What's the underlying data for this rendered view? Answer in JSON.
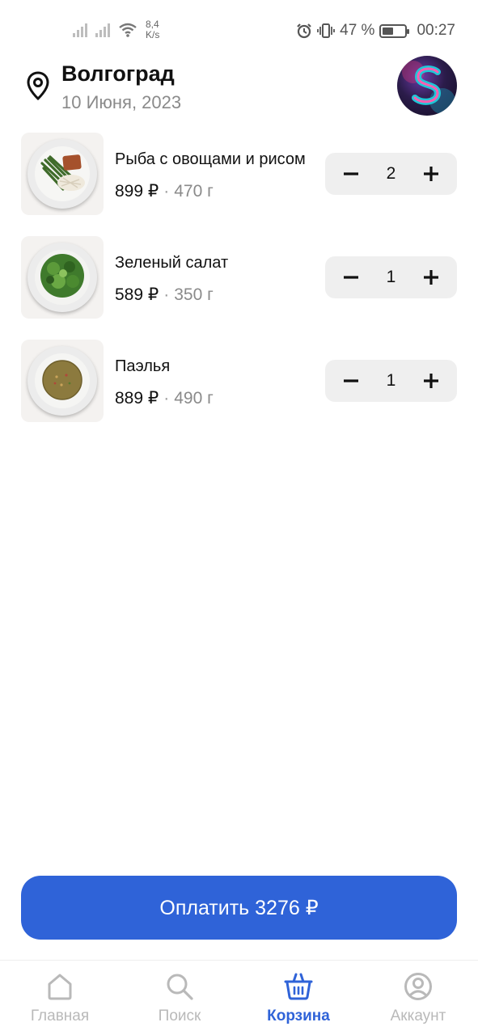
{
  "status_bar": {
    "net_speed_value": "8,4",
    "net_speed_unit": "K/s",
    "battery_percent": "47 %",
    "battery_level": 0.47,
    "time": "00:27"
  },
  "header": {
    "city": "Волгоград",
    "date": "10 Июня, 2023"
  },
  "cart": {
    "items": [
      {
        "name": "Рыба с овощами и рисом",
        "price": "899 ₽",
        "separator": "·",
        "weight": "470 г",
        "quantity": "2"
      },
      {
        "name": "Зеленый салат",
        "price": "589 ₽",
        "separator": "·",
        "weight": "350 г",
        "quantity": "1"
      },
      {
        "name": "Паэлья",
        "price": "889 ₽",
        "separator": "·",
        "weight": "490 г",
        "quantity": "1"
      }
    ]
  },
  "pay_button": {
    "label": "Оплатить 3276 ₽"
  },
  "bottom_nav": {
    "items": [
      {
        "label": "Главная",
        "icon": "home-icon"
      },
      {
        "label": "Поиск",
        "icon": "search-icon"
      },
      {
        "label": "Корзина",
        "icon": "basket-icon",
        "active": true
      },
      {
        "label": "Аккаунт",
        "icon": "account-icon"
      }
    ]
  },
  "colors": {
    "accent": "#2f63d8",
    "inactive_nav": "#b9b9b9",
    "secondary_text": "#8a8a8a",
    "stepper_bg": "#efefef"
  }
}
